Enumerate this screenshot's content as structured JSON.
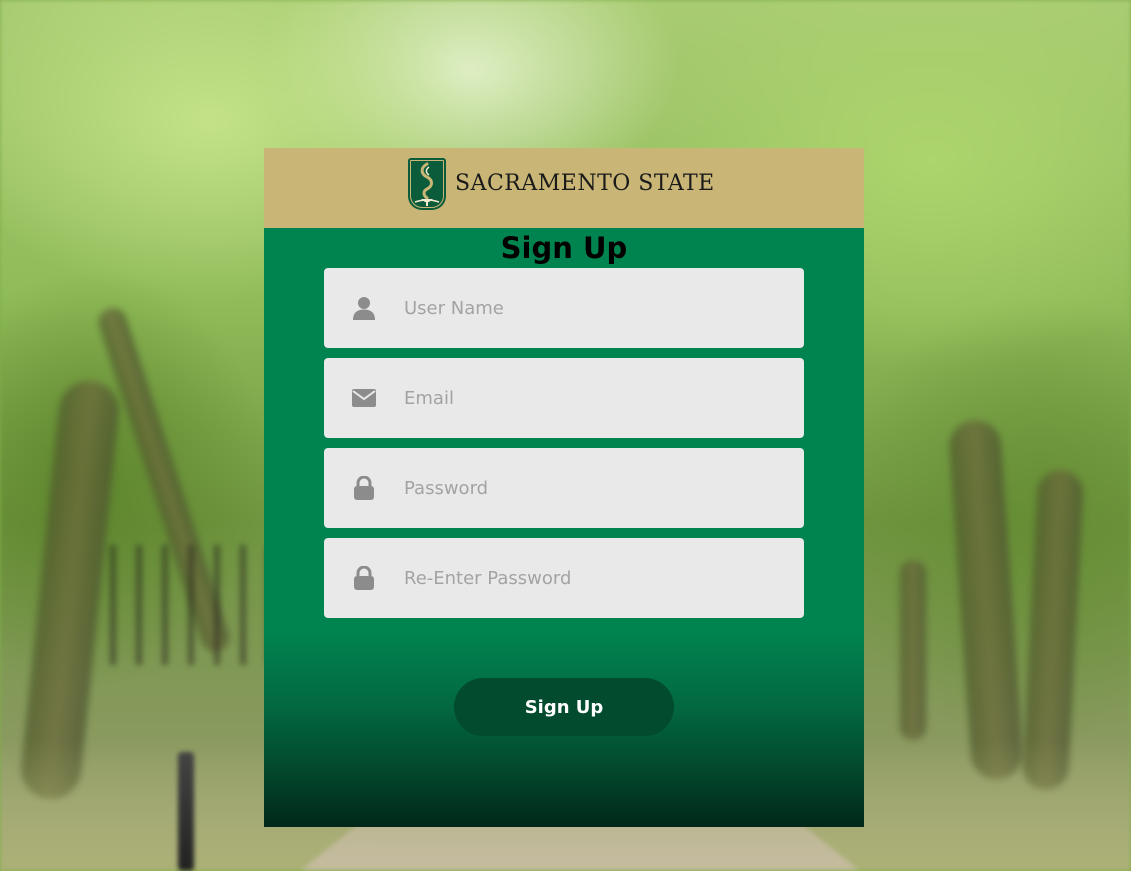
{
  "header": {
    "logo_text": "SACRAMENTO STATE"
  },
  "form": {
    "title": "Sign Up",
    "fields": [
      {
        "icon": "user-icon",
        "placeholder": "User Name",
        "value": ""
      },
      {
        "icon": "envelope-icon",
        "placeholder": "Email",
        "value": ""
      },
      {
        "icon": "lock-icon",
        "placeholder": "Password",
        "value": ""
      },
      {
        "icon": "lock-icon",
        "placeholder": "Re-Enter Password",
        "value": ""
      }
    ],
    "submit_label": "Sign Up"
  },
  "colors": {
    "header_gold": "#c9b676",
    "card_green": "#00844f",
    "button_green": "#034b2e",
    "input_bg": "#e9e9e9",
    "icon_gray": "#8c8c8c",
    "brand_green": "#0a5c3a"
  }
}
